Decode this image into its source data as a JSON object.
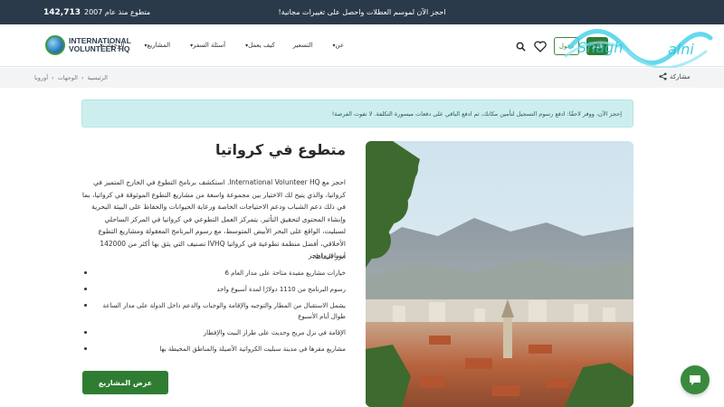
{
  "topbar": {
    "promo": "احجز الآن لموسم العطلات واحصل على تغييرات مجانية!",
    "stat_label": "متطوع منذ عام 2007",
    "stat_value": "142,713"
  },
  "logo": {
    "line1": "INTERNATIONAL",
    "line2": "VOLUNTEER HQ"
  },
  "nav": {
    "items": [
      "عن",
      "التسعير",
      "كيف يعمل",
      "أسئلة السفر",
      "المشاريع",
      "الوجهات"
    ],
    "login": "دخول",
    "apply": "قدم"
  },
  "breadcrumb": {
    "items": [
      "الرئيسية",
      "الوجهات",
      "أوروبا"
    ],
    "share": "مشاركة"
  },
  "notice": "إحجز الآن، ووفر لاحقًا: ادفع رسوم التسجيل لتأمين مكانك، ثم ادفع الباقي على دفعات ميسورة التكلفة. لا تفوت الفرصة!",
  "page": {
    "title": "متطوع في كرواتيا",
    "intro": "احجز مع International Volunteer HQ. استكشف برنامج التطوع في الخارج المتميز في كرواتيا، والذي يتيح لك الاختيار بين مجموعة واسعة من مشاريع التطوع الموثوقة في كرواتيا، بما في ذلك دعم الشباب ودعم الاحتياجات الخاصة ورعاية الحيوانات والحفاظ على البيئة البحرية وإنشاء المحتوى لتحقيق التأثير. يتمركز العمل التطوعي في كرواتيا في المركز الساحلي لسبليت، الواقع على البحر الأبيض المتوسط، مع رسوم البرنامج المعقولة ومشاريع التطوع الأخلاقي، أفضل منظمة تطوعية في كرواتيا IVHQ تصنيف التي يثق بها أكثر من 142000 مسافر، احجز",
    "highlights_title": "أبرز النقاط:",
    "highlights": [
      "خيارات مشاريع مفيدة متاحة على مدار العام 6",
      "رسوم البرنامج من 1110 دولارًا لمدة أسبوع واحد",
      "يشمل الاستقبال من المطار والتوجيه والإقامة والوجبات والدعم داخل الدولة على مدار الساعة طوال أيام الأسبوع",
      "الإقامة في نزل مريح وحديث على طراز البيت والإفطار",
      "مشاريع مقرها في مدينة سبليت الكرواتية الأصيلة والمناطق المحيطة بها"
    ],
    "cta": "عرض المشاريع"
  },
  "colors": {
    "topbar": "#2b3a4a",
    "brand_green": "#2f7d32",
    "notice_bg": "#cdeeee"
  }
}
